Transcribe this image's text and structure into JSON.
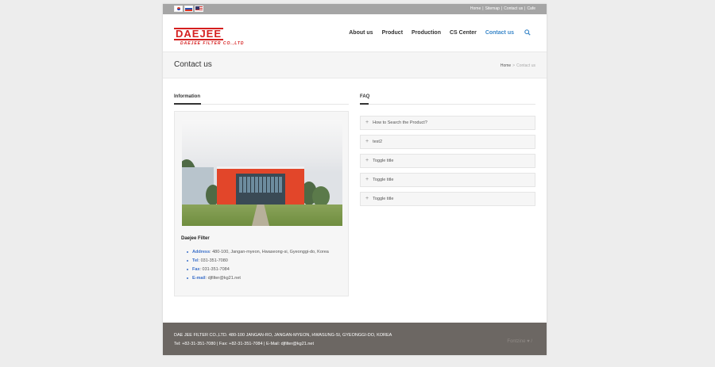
{
  "topbar": {
    "flags": [
      "korea-flag-icon",
      "russia-flag-icon",
      "usa-flag-icon"
    ],
    "links": [
      "Home",
      "Sitemap",
      "Contact us",
      "Cafe"
    ],
    "separator": "|"
  },
  "header": {
    "logo_main": "DAEJEE",
    "logo_sub": "DAEJEE FILTER CO.,LTD",
    "nav": [
      "About us",
      "Product",
      "Production",
      "CS Center",
      "Contact us"
    ],
    "active_nav": "Contact us",
    "search_icon": "search-icon"
  },
  "titlebar": {
    "title": "Contact us",
    "breadcrumb_home": "Home",
    "breadcrumb_sep": ">",
    "breadcrumb_current": "Contact us"
  },
  "information": {
    "heading": "Information",
    "company": "Daejee Filter",
    "items": [
      {
        "label": "Address",
        "value": ": 480-100, Jangan-myeon, Hwaseong-si, Gyeonggi-do, Korea"
      },
      {
        "label": "Tel",
        "value": ": 031-351-7080"
      },
      {
        "label": "Fax",
        "value": ": 031-351-7084"
      },
      {
        "label": "E-mail",
        "value": ": djfilter@kg21.net"
      }
    ]
  },
  "faq": {
    "heading": "FAQ",
    "items": [
      "How to Search the Product?",
      "test2",
      "Toggle title",
      "Toggle title",
      "Toggle title"
    ],
    "toggle_symbol": "+"
  },
  "footer": {
    "line1": "DAE JEE FILTER CO.,LTD. 480-100 JANGAN-RO, JANGAN-MYEON, HWASUNG-SI, GYEONGGI-DO, KOREA",
    "line2": "Tel: +82-31-351-7080 | Fax: +82-31-351-7084 | E-Mail: djfilter@kg21.net",
    "right": "Fontzine ♥ /"
  },
  "colors": {
    "accent_blue": "#3a87c9",
    "brand_red": "#d51f1f",
    "footer_bg": "#6c6763",
    "topbar_bg": "#a5a5a5"
  }
}
